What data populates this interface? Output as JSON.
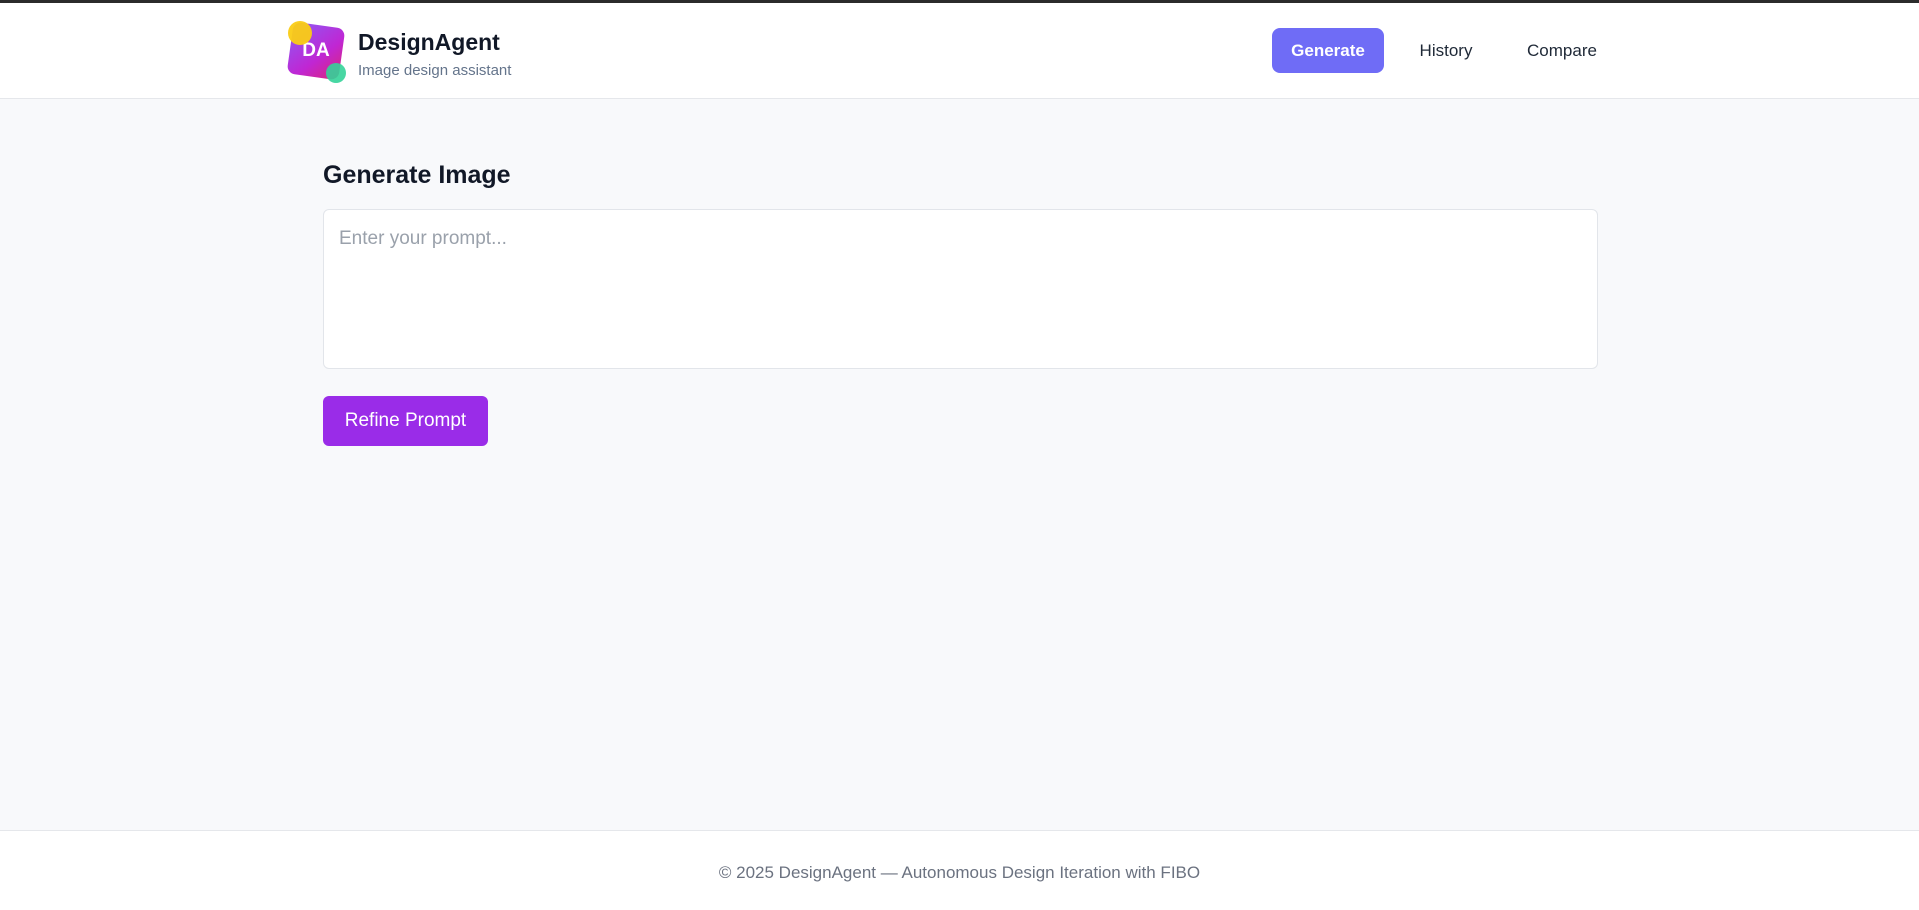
{
  "brand": {
    "logo_text": "DA",
    "title": "DesignAgent",
    "subtitle": "Image design assistant"
  },
  "nav": {
    "items": [
      {
        "label": "Generate",
        "active": true
      },
      {
        "label": "History",
        "active": false
      },
      {
        "label": "Compare",
        "active": false
      }
    ]
  },
  "main": {
    "title": "Generate Image",
    "prompt": {
      "value": "",
      "placeholder": "Enter your prompt..."
    },
    "refine_button": "Refine Prompt"
  },
  "footer": {
    "text": "© 2025 DesignAgent — Autonomous Design Iteration with FIBO"
  },
  "colors": {
    "nav_active": "#6f6cf6",
    "primary_button": "#9a2ce8",
    "background": "#f8f9fb"
  },
  "icons": [
    "app-logo"
  ]
}
